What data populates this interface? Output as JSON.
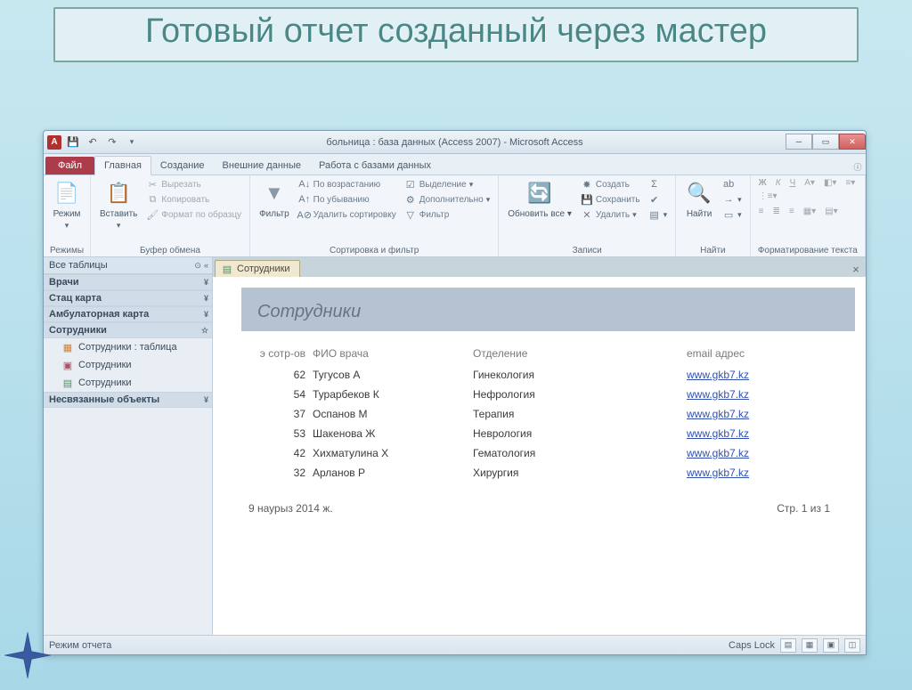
{
  "slide": {
    "title": "Готовый отчет созданный через мастер"
  },
  "window": {
    "title": "больница : база данных (Access 2007)  -  Microsoft Access",
    "app_letter": "A"
  },
  "tabs": {
    "file": "Файл",
    "home": "Главная",
    "create": "Создание",
    "external": "Внешние данные",
    "dbtools": "Работа с базами данных"
  },
  "ribbon": {
    "views_group": "Режимы",
    "view_btn": "Режим",
    "clipboard_group": "Буфер обмена",
    "paste_btn": "Вставить",
    "cut": "Вырезать",
    "copy": "Копировать",
    "format_painter": "Формат по образцу",
    "sortfilter_group": "Сортировка и фильтр",
    "filter_btn": "Фильтр",
    "asc": "По возрастанию",
    "desc": "По убыванию",
    "clear_sort": "Удалить сортировку",
    "selection": "Выделение",
    "advanced": "Дополнительно",
    "toggle_filter": "Фильтр",
    "records_group": "Записи",
    "refresh_btn": "Обновить все",
    "new_rec": "Создать",
    "save_rec": "Сохранить",
    "delete_rec": "Удалить",
    "find_group": "Найти",
    "find_btn": "Найти",
    "textfmt_group": "Форматирование текста"
  },
  "nav": {
    "header": "Все таблицы",
    "sections": {
      "doctors": "Врачи",
      "stac": "Стац карта",
      "amb": "Амбулаторная карта",
      "staff": "Сотрудники",
      "unlinked": "Несвязанные объекты"
    },
    "items": {
      "staff_table": "Сотрудники : таблица",
      "staff_form": "Сотрудники",
      "staff_report": "Сотрудники"
    }
  },
  "doc": {
    "tab_label": "Сотрудники",
    "report_title": "Сотрудники",
    "columns": {
      "id": "э сотр-ов",
      "fio": "ФИО врача",
      "dep": "Отделение",
      "email": "email адрес"
    },
    "rows": [
      {
        "id": "62",
        "fio": "Тугусов А",
        "dep": "Гинекология",
        "email": "www.gkb7.kz"
      },
      {
        "id": "54",
        "fio": "Турарбеков К",
        "dep": "Нефрология",
        "email": "www.gkb7.kz"
      },
      {
        "id": "37",
        "fio": "Оспанов М",
        "dep": "Терапия",
        "email": "www.gkb7.kz"
      },
      {
        "id": "53",
        "fio": "Шакенова Ж",
        "dep": "Неврология",
        "email": "www.gkb7.kz"
      },
      {
        "id": "42",
        "fio": "Хихматулина Х",
        "dep": "Гематология",
        "email": "www.gkb7.kz"
      },
      {
        "id": "32",
        "fio": "Арланов Р",
        "dep": "Хирургия",
        "email": "www.gkb7.kz"
      }
    ],
    "footer_date": "9 наурыз 2014 ж.",
    "footer_page": "Стр. 1 из 1"
  },
  "status": {
    "mode": "Режим отчета",
    "caps": "Caps Lock"
  }
}
